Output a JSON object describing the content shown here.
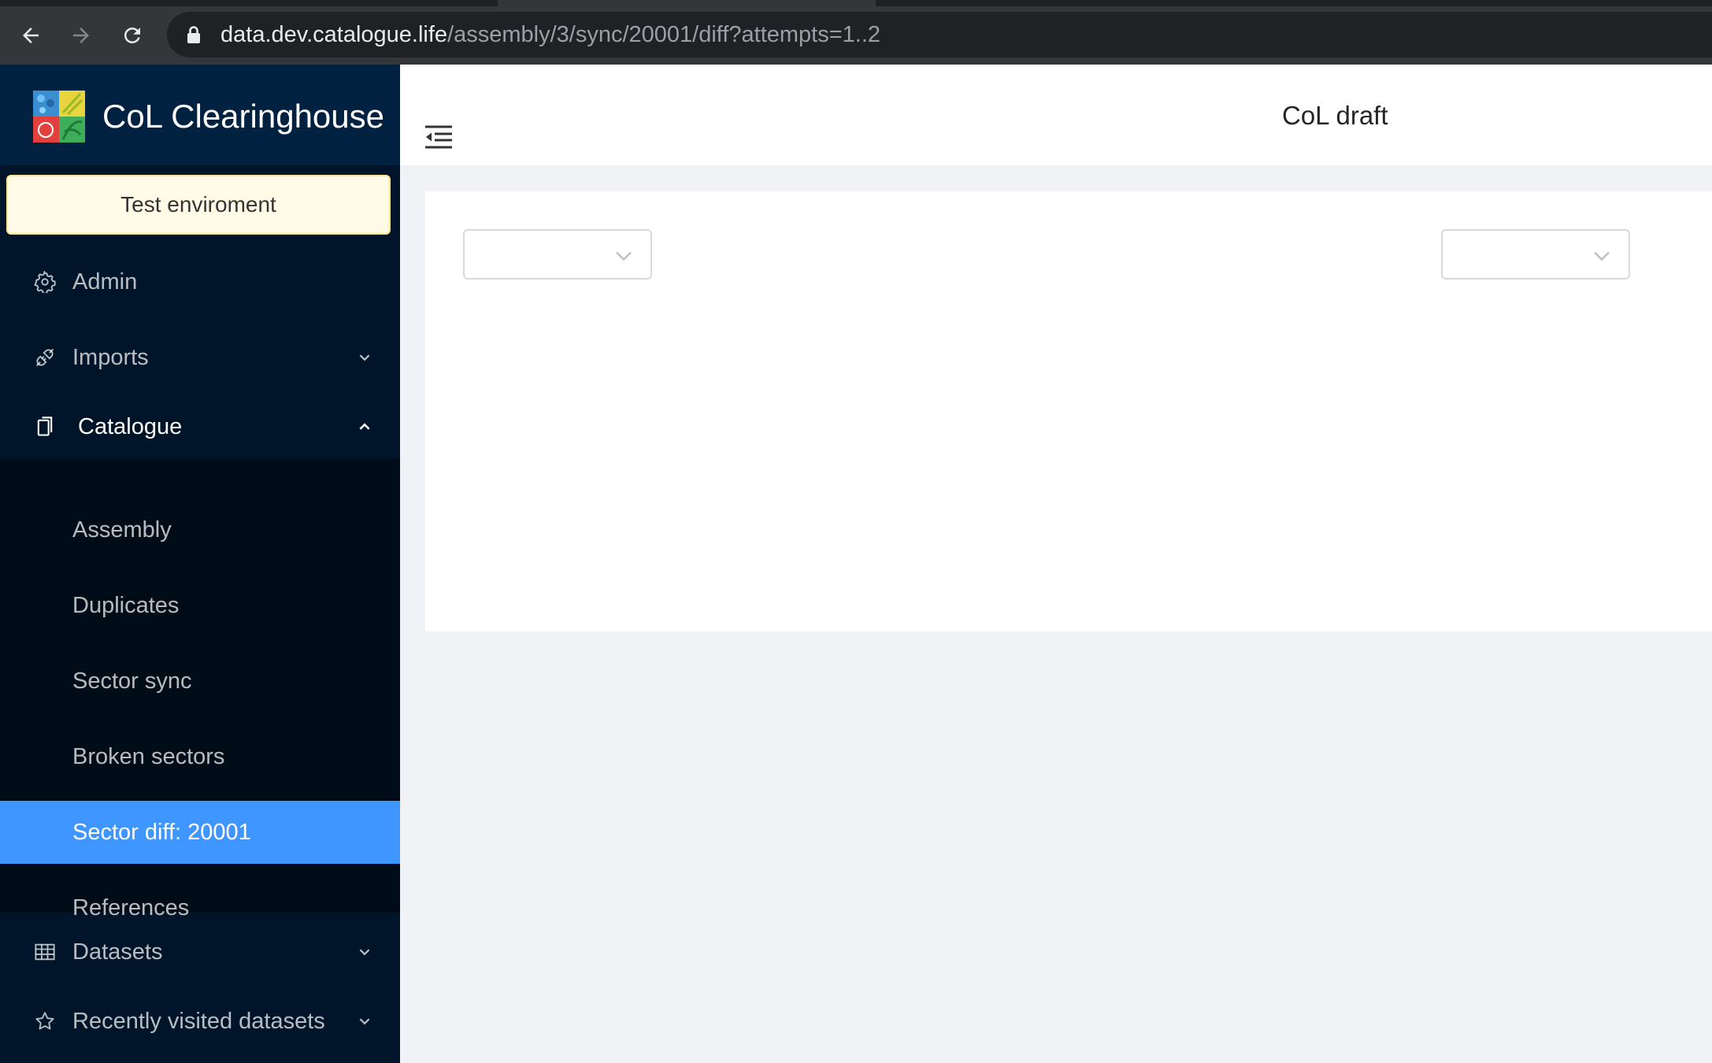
{
  "browser": {
    "url_host": "data.dev.catalogue.life",
    "url_path": "/assembly/3/sync/20001/diff?attempts=1..2"
  },
  "app": {
    "title": "CoL Clearinghouse",
    "environment_badge": "Test enviroment"
  },
  "sidebar": {
    "items": [
      {
        "label": "Admin",
        "icon": "gear-icon"
      },
      {
        "label": "Imports",
        "icon": "api-icon",
        "expandable": true
      },
      {
        "label": "Catalogue",
        "icon": "copy-icon",
        "expanded": true
      },
      {
        "label": "Datasets",
        "icon": "table-icon",
        "expandable": true
      },
      {
        "label": "Recently visited datasets",
        "icon": "star-icon",
        "expandable": true
      }
    ],
    "catalogue_children": [
      {
        "label": "Assembly"
      },
      {
        "label": "Duplicates"
      },
      {
        "label": "Sector sync"
      },
      {
        "label": "Broken sectors"
      },
      {
        "label": "Sector diff: 20001",
        "selected": true
      },
      {
        "label": "References"
      }
    ]
  },
  "header": {
    "title": "CoL draft"
  },
  "diff": {
    "left_select_value": "",
    "right_select_value": ""
  },
  "colors": {
    "sidebar_bg": "#001529",
    "brand_bg": "#002140",
    "submenu_bg": "#000c17",
    "selected": "#4096ff",
    "page_bg": "#f0f2f5",
    "badge_bg": "#fffbe6"
  }
}
